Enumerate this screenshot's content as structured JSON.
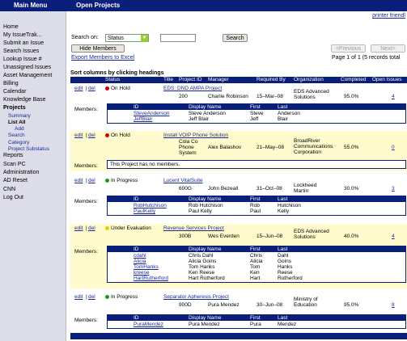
{
  "topbar": {
    "main_menu": "Main Menu",
    "page_title": "Open Projects"
  },
  "sidebar": {
    "items": [
      {
        "label": "Home"
      },
      {
        "label": "My IssueTrak..."
      },
      {
        "label": "Submit an Issue"
      },
      {
        "label": "Search Issues"
      },
      {
        "label": "Lookup Issue #"
      },
      {
        "label": "Unassigned Issues"
      },
      {
        "label": "Asset Management"
      },
      {
        "label": "Billing"
      },
      {
        "label": "Calendar"
      },
      {
        "label": "Knowledge Base"
      },
      {
        "label": "Projects"
      },
      {
        "label": "Summary"
      },
      {
        "label": "List All"
      },
      {
        "label": "Add"
      },
      {
        "label": "Search"
      },
      {
        "label": "Category"
      },
      {
        "label": "Project Substatus"
      },
      {
        "label": "Reports"
      },
      {
        "label": "Scan PC"
      },
      {
        "label": "Administration"
      },
      {
        "label": "AD Reset"
      },
      {
        "label": "CNN"
      },
      {
        "label": "Log Out"
      }
    ]
  },
  "toolbar": {
    "printer_friendly": "printer friendl",
    "search_on_label": "Search on:",
    "search_on_value": "Status",
    "search_button": "Search",
    "hide_members": "Hide Members",
    "previous": "<Previous",
    "next": "Next>",
    "export": "Export Members to Excel",
    "page_info": "Page 1 of 1 (5 records total"
  },
  "table": {
    "sort_hint": "Sort columns by clicking headings",
    "headers": [
      "Status",
      "Title",
      "Project ID",
      "Manager",
      "Required By",
      "Organization",
      "Completed",
      "Open Issues"
    ],
    "edit": "edit",
    "del": "del",
    "members_label": "Members:",
    "member_headers": [
      "ID",
      "Display Name",
      "First",
      "Last"
    ],
    "no_members": "This Project has no members.",
    "rows": [
      {
        "status": "On Hold",
        "status_color": "#cc0000",
        "title": "EDS: DND AMPA Project",
        "project_id": "200",
        "manager": "Charlie Robinson",
        "required_by": "15–Mar–08",
        "org1": "EDS Advanced",
        "org2": "Solutions",
        "org3": "",
        "completed": "95.0%",
        "open_issues": "4",
        "members": [
          {
            "id": "SteveAnderson",
            "name": "Steve Anderson",
            "first": "Steve",
            "last": "Anderson"
          },
          {
            "id": "JeffBlair",
            "name": "Jeff Blair",
            "first": "Jeff",
            "last": "Blair"
          }
        ]
      },
      {
        "status": "On Hold",
        "status_color": "#cc0000",
        "title": "Install VOIP Phone Solution",
        "project_id": "Cola Co",
        "project_id2": "Phone",
        "project_id3": "System",
        "manager": "Alex Balashov",
        "required_by": "21–May–08",
        "org1": "BroadRiver",
        "org2": "Communications",
        "org3": "Corporation",
        "completed": "55.0%",
        "open_issues": "0",
        "members": []
      },
      {
        "status": "In Progress",
        "status_color": "#1a9a1a",
        "title": "Lucent VitalSuite",
        "project_id": "600G",
        "manager": "John Bezeall",
        "required_by": "31–Oct–08",
        "org1": "Lockheed",
        "org2": "Martin",
        "org3": "",
        "completed": "30.0%",
        "open_issues": "3",
        "members": [
          {
            "id": "RobHutchison",
            "name": "Rob Hutchison",
            "first": "Rob",
            "last": "Hutchison"
          },
          {
            "id": "PaulKelly",
            "name": "Paul Kelly",
            "first": "Paul",
            "last": "Kelly"
          }
        ]
      },
      {
        "status": "Under Evaluation",
        "status_color": "#e0d000",
        "title": "Revenue Services Project",
        "project_id": "300B",
        "manager": "Wes Everden",
        "required_by": "15–Jun–08",
        "org1": "EDS Advanced",
        "org2": "Solutions",
        "org3": "",
        "completed": "40.0%",
        "open_issues": "4",
        "members": [
          {
            "id": "cdahl",
            "name": "Chris Dahl",
            "first": "Chris",
            "last": "Dahl"
          },
          {
            "id": "Alicia",
            "name": "Alicia Goins",
            "first": "Alicia",
            "last": "Goins"
          },
          {
            "id": "TomHanks",
            "name": "Tom Hanks",
            "first": "Tom",
            "last": "Hanks"
          },
          {
            "id": "kreese",
            "name": "Ken Reese",
            "first": "Ken",
            "last": "Reese"
          },
          {
            "id": "HartRutherford",
            "name": "Hart Rutherford",
            "first": "Hart",
            "last": "Rutherford"
          }
        ]
      },
      {
        "status": "In Progress",
        "status_color": "#1a9a1a",
        "title": "Separator Apheresis Project",
        "project_id": "900D",
        "manager": "Pura Mendez",
        "required_by": "30–Jun–08",
        "org1": "Ministry of",
        "org2": "Education",
        "org3": "",
        "completed": "95.0%",
        "open_issues": "8",
        "members": [
          {
            "id": "PuraMendez",
            "name": "Pura Mendez",
            "first": "Pura",
            "last": "Mendez"
          }
        ]
      }
    ]
  }
}
